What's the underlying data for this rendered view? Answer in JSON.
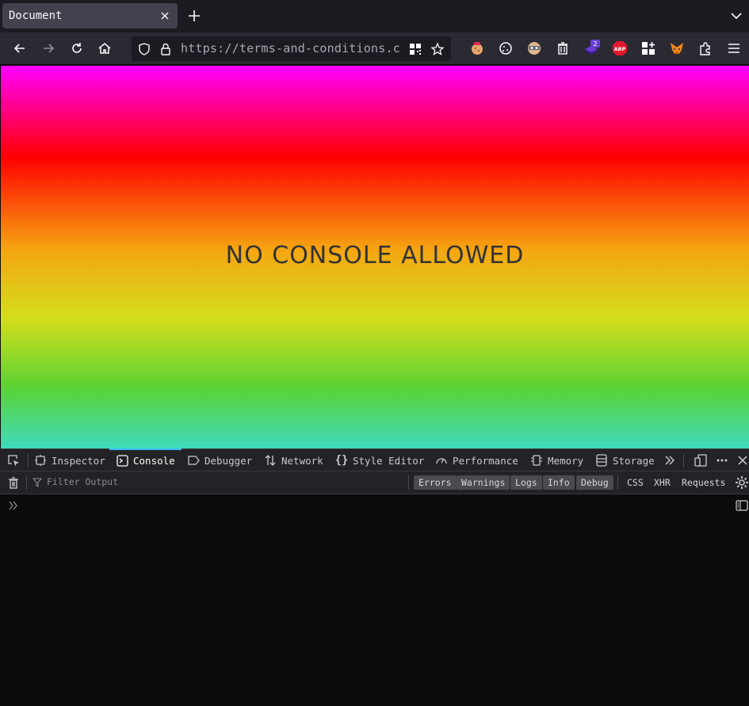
{
  "tab": {
    "title": "Document"
  },
  "url": {
    "text": "https://terms-and-conditions.c"
  },
  "page": {
    "headline": "NO CONSOLE ALLOWED"
  },
  "extensions": {
    "badge_count": "2",
    "abp_label": "ABP"
  },
  "devtools": {
    "tabs": [
      {
        "label": "Inspector",
        "icon": "inspector-icon"
      },
      {
        "label": "Console",
        "icon": "console-icon",
        "active": true
      },
      {
        "label": "Debugger",
        "icon": "debugger-icon"
      },
      {
        "label": "Network",
        "icon": "network-icon"
      },
      {
        "label": "Style Editor",
        "icon": "style-editor-icon"
      },
      {
        "label": "Performance",
        "icon": "performance-icon"
      },
      {
        "label": "Memory",
        "icon": "memory-icon"
      },
      {
        "label": "Storage",
        "icon": "storage-icon"
      }
    ],
    "filter_placeholder": "Filter Output",
    "levels": [
      "Errors",
      "Warnings",
      "Logs",
      "Info",
      "Debug"
    ],
    "types": [
      "CSS",
      "XHR",
      "Requests"
    ]
  },
  "colors": {
    "accent": "#3dbbff",
    "gradient": [
      "#ff00ff",
      "#ff0000",
      "#f5a511",
      "#d4de1c",
      "#5bd234",
      "#3fdbbd"
    ]
  }
}
